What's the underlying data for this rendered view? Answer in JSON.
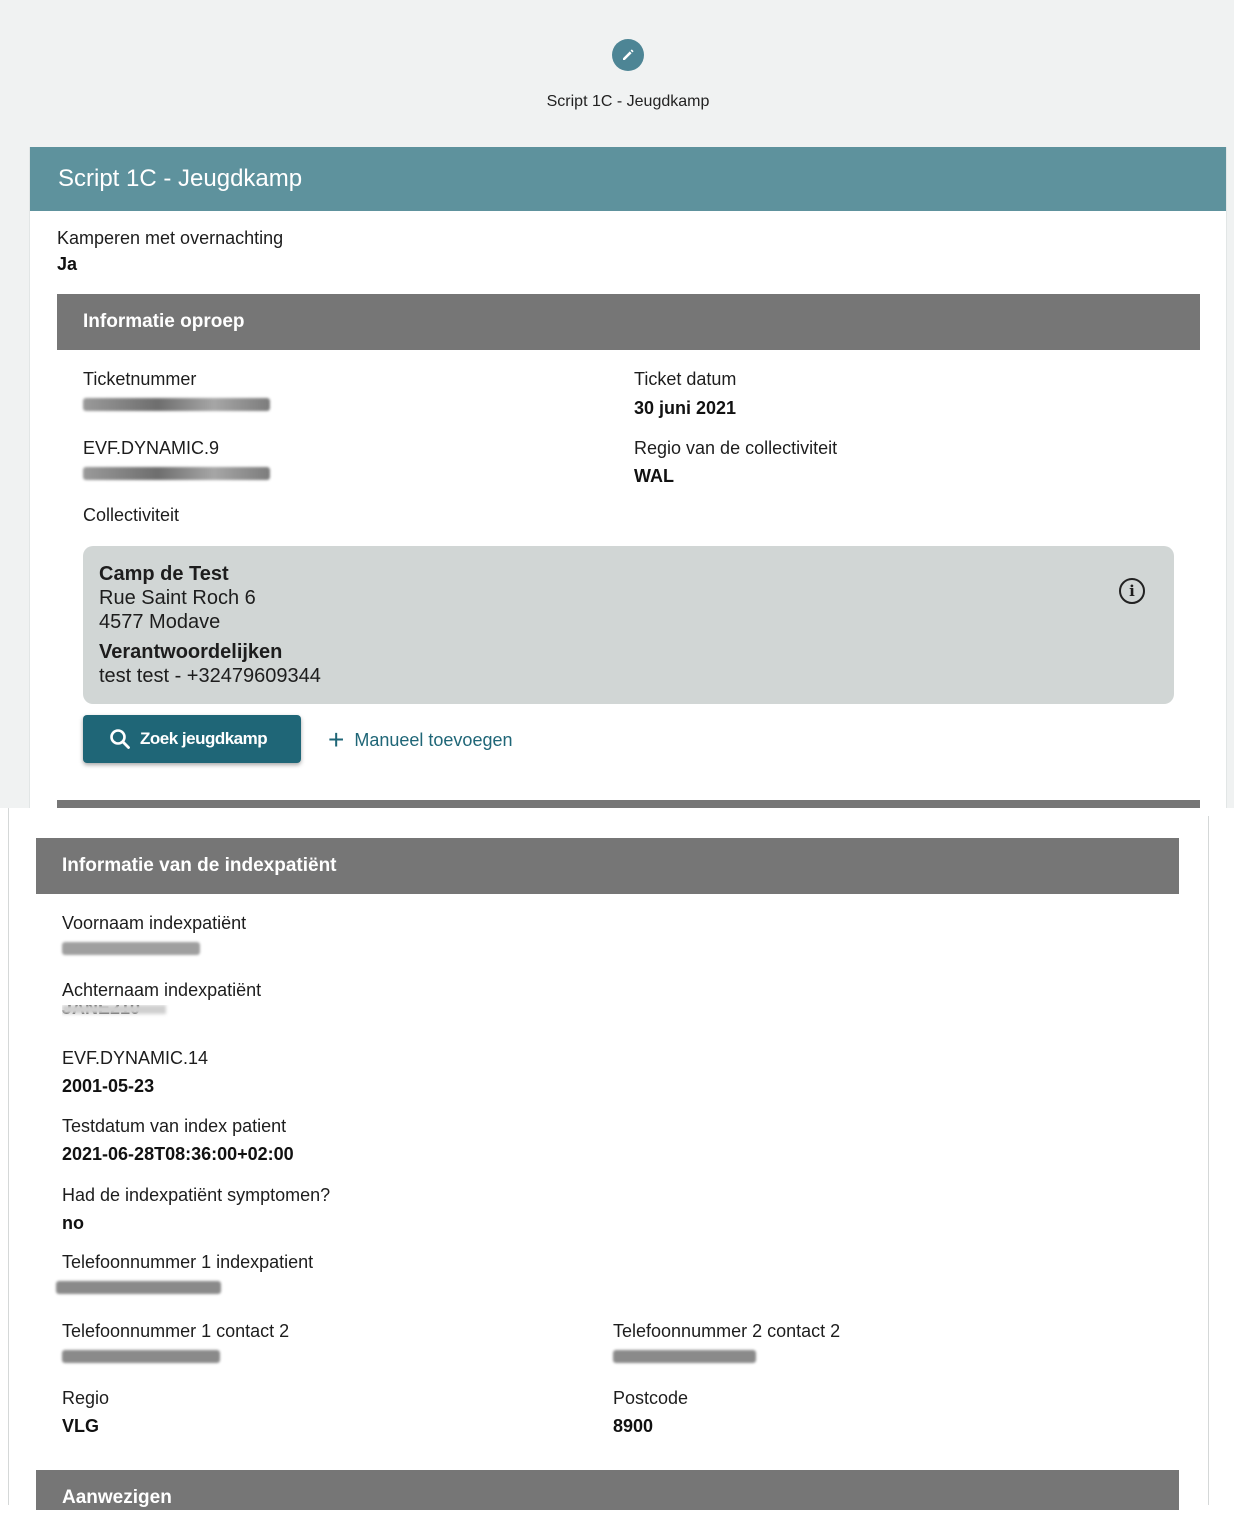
{
  "step": {
    "icon": "pencil-icon",
    "label": "Script 1C - Jeugdkamp"
  },
  "card": {
    "title": "Script 1C - Jeugdkamp"
  },
  "camping": {
    "label": "Kamperen met overnachting",
    "value": "Ja"
  },
  "info_call": {
    "title": "Informatie oproep",
    "ticket_number": {
      "label": "Ticketnummer"
    },
    "ticket_date": {
      "label": "Ticket datum",
      "value": "30 juni 2021"
    },
    "dynamic9": {
      "label": "EVF.DYNAMIC.9"
    },
    "region": {
      "label": "Regio van de collectiviteit",
      "value": "WAL"
    },
    "collectivity": {
      "label": "Collectiviteit"
    }
  },
  "collectivity_card": {
    "name": "Camp de Test",
    "street": "Rue Saint Roch 6",
    "city": "4577 Modave",
    "responsibles_heading": "Verantwoordelijken",
    "responsibles": "test test - +32479609344",
    "info_icon": "info-icon"
  },
  "actions": {
    "search_label": "Zoek jeugdkamp",
    "search_icon": "search-icon",
    "manual_label": "Manueel toevoegen",
    "manual_icon": "plus-icon"
  },
  "index_patient": {
    "title": "Informatie van de indexpatiënt",
    "first_name": {
      "label": "Voornaam indexpatiënt"
    },
    "last_name": {
      "label": "Achternaam indexpatiënt",
      "value": "JANE210"
    },
    "dynamic14": {
      "label": "EVF.DYNAMIC.14",
      "value": "2001-05-23"
    },
    "test_date": {
      "label": "Testdatum van index patient",
      "value": "2021-06-28T08:36:00+02:00"
    },
    "symptoms": {
      "label": "Had de indexpatiënt symptomen?",
      "value": "no"
    },
    "phone1": {
      "label": "Telefoonnummer 1 indexpatient"
    },
    "phone1_contact2": {
      "label": "Telefoonnummer 1 contact 2"
    },
    "phone2_contact2": {
      "label": "Telefoonnummer 2 contact 2"
    },
    "region": {
      "label": "Regio",
      "value": "VLG"
    },
    "postcode": {
      "label": "Postcode",
      "value": "8900"
    }
  },
  "present": {
    "title": "Aanwezigen"
  }
}
